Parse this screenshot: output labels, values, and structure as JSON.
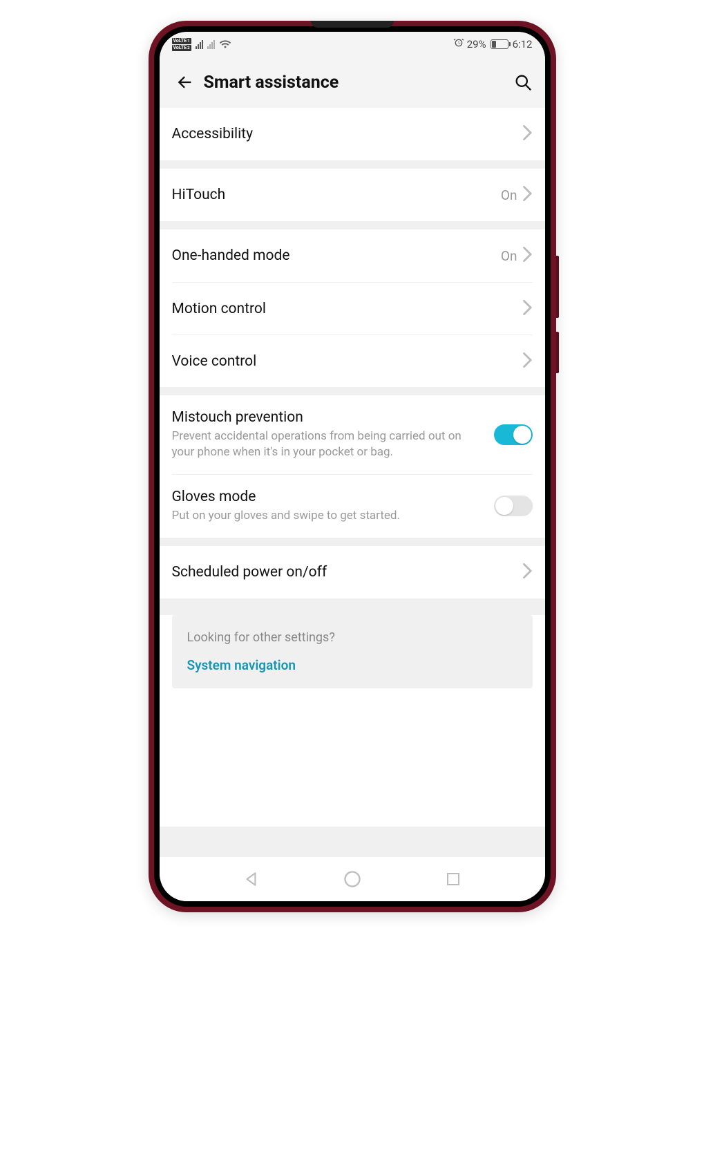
{
  "status": {
    "volte1": "VoLTE",
    "volte1_sub": "1",
    "volte2": "VoLTE",
    "volte2_sub": "2",
    "battery_pct": "29%",
    "time": "6:12"
  },
  "header": {
    "title": "Smart assistance"
  },
  "rows": {
    "accessibility": {
      "label": "Accessibility"
    },
    "hitouch": {
      "label": "HiTouch",
      "value": "On"
    },
    "one_handed": {
      "label": "One-handed mode",
      "value": "On"
    },
    "motion": {
      "label": "Motion control"
    },
    "voice": {
      "label": "Voice control"
    },
    "mistouch": {
      "label": "Mistouch prevention",
      "desc": "Prevent accidental operations from being carried out on your phone when it's in your pocket or bag.",
      "on": true
    },
    "gloves": {
      "label": "Gloves mode",
      "desc": "Put on your gloves and swipe to get started.",
      "on": false
    },
    "sched_power": {
      "label": "Scheduled power on/off"
    }
  },
  "footer": {
    "question": "Looking for other settings?",
    "link": "System navigation"
  }
}
